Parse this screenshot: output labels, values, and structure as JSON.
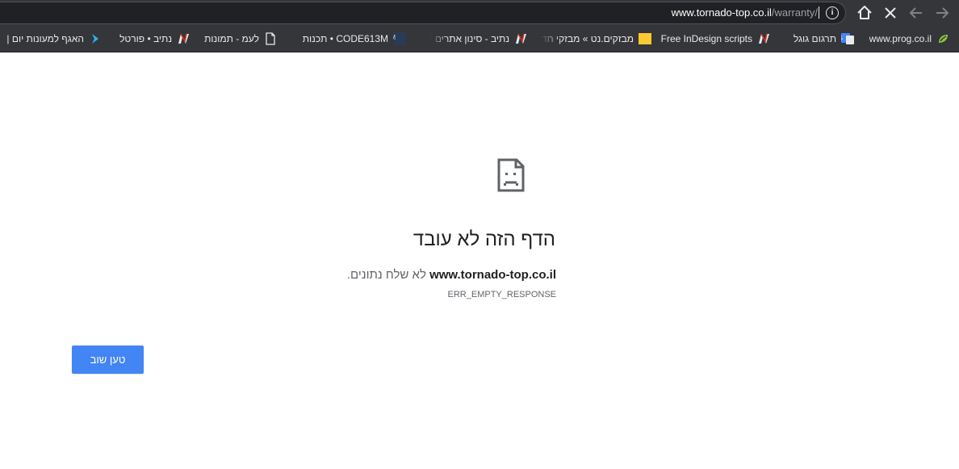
{
  "omnibox": {
    "host": "www.tornado-top.co.il",
    "path": "/warranty/"
  },
  "bookmarks": [
    {
      "label": "www.prog.co.il",
      "icon": "prog-leaf-icon"
    },
    {
      "label": "תרגום גוגל",
      "icon": "google-translate-icon"
    },
    {
      "label": "Free InDesign scripts",
      "icon": "netiv-n-icon"
    },
    {
      "label": "מבזקים.נט » מבזקי חד",
      "icon": "yellow-folder-icon"
    },
    {
      "label": "נתיב - סינון אתרים / א",
      "icon": "netiv-n-icon"
    },
    {
      "label": "CODE613M • תכנות",
      "icon": "code613-icon"
    },
    {
      "label": "לעמ - תמונות",
      "icon": "page-icon"
    },
    {
      "label": "נתיב • פורטל",
      "icon": "netiv-n-icon"
    },
    {
      "label": "האגף למעונות יום |",
      "icon": "blue-chevron-icon"
    }
  ],
  "error": {
    "title": "הדף הזה לא עובד",
    "host": "www.tornado-top.co.il",
    "message": "לא שלח נתונים.",
    "code": "ERR_EMPTY_RESPONSE",
    "reload_label": "טען שוב"
  },
  "colors": {
    "toolbar_bg": "#35363a",
    "omnibox_bg": "#202124",
    "button_blue": "#4285f4"
  }
}
